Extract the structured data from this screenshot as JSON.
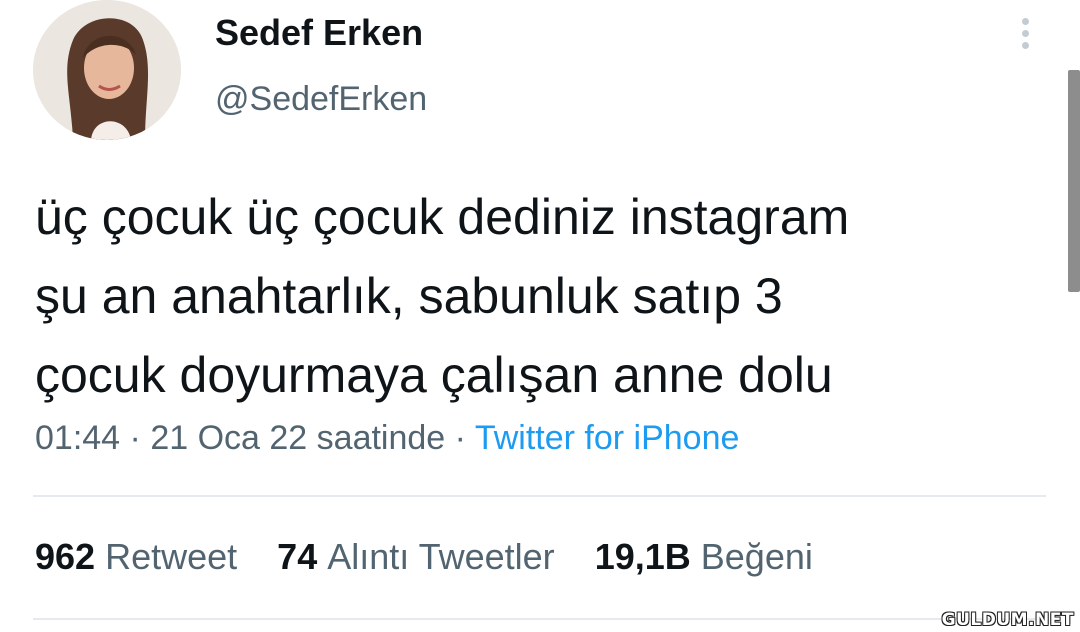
{
  "user": {
    "display_name": "Sedef Erken",
    "handle": "@SedefErken"
  },
  "tweet": {
    "lines": [
      "üç çocuk üç çocuk dediniz instagram",
      "şu an anahtarlık, sabunluk satıp 3",
      "çocuk doyurmaya çalışan anne dolu"
    ],
    "time": "01:44",
    "date": "21 Oca 22 saatinde",
    "separator": "·",
    "source": "Twitter for iPhone"
  },
  "stats": {
    "retweets": {
      "count": "962",
      "label": "Retweet"
    },
    "quotes": {
      "count": "74",
      "label": "Alıntı Tweetler"
    },
    "likes": {
      "count": "19,1B",
      "label": "Beğeni"
    }
  },
  "icons": {
    "more": "more-vertical-icon"
  },
  "colors": {
    "text": "#0f1419",
    "secondary": "#536471",
    "link": "#1d9bf0"
  },
  "watermark": "GULDUM.NET"
}
